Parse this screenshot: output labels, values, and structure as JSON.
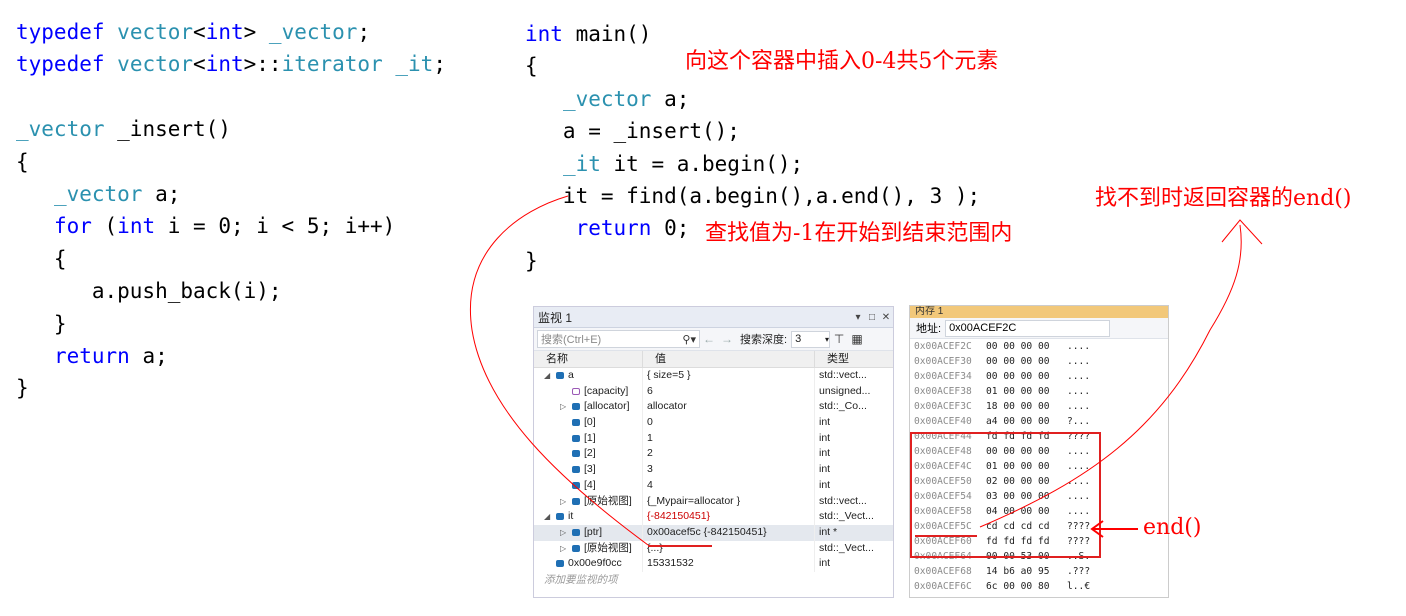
{
  "left_code": {
    "lines": [
      [
        {
          "t": "typedef",
          "c": "kw"
        },
        {
          "t": " "
        },
        {
          "t": "vector",
          "c": "ty"
        },
        {
          "t": "<"
        },
        {
          "t": "int",
          "c": "kw"
        },
        {
          "t": "> "
        },
        {
          "t": "_vector",
          "c": "ty"
        },
        {
          "t": ";"
        }
      ],
      [
        {
          "t": "typedef",
          "c": "kw"
        },
        {
          "t": " "
        },
        {
          "t": "vector",
          "c": "ty"
        },
        {
          "t": "<"
        },
        {
          "t": "int",
          "c": "kw"
        },
        {
          "t": ">::"
        },
        {
          "t": "iterator",
          "c": "ty"
        },
        {
          "t": " "
        },
        {
          "t": "_it",
          "c": "ty"
        },
        {
          "t": ";"
        }
      ],
      [],
      [
        {
          "t": "_vector",
          "c": "ty"
        },
        {
          "t": " _insert()"
        }
      ],
      [
        {
          "t": "{"
        }
      ],
      [
        {
          "t": "   "
        },
        {
          "t": "_vector",
          "c": "ty"
        },
        {
          "t": " a;"
        }
      ],
      [
        {
          "t": "   "
        },
        {
          "t": "for",
          "c": "kw"
        },
        {
          "t": " ("
        },
        {
          "t": "int",
          "c": "kw"
        },
        {
          "t": " i = 0; i < 5; i++)"
        }
      ],
      [
        {
          "t": "   {"
        }
      ],
      [
        {
          "t": "      a.push_back(i);"
        }
      ],
      [
        {
          "t": "   }"
        }
      ],
      [
        {
          "t": "   "
        },
        {
          "t": "return",
          "c": "kw"
        },
        {
          "t": " a;"
        }
      ],
      [
        {
          "t": "}"
        }
      ]
    ]
  },
  "right_code": {
    "lines": [
      [
        {
          "t": "int",
          "c": "kw"
        },
        {
          "t": " main()"
        }
      ],
      [
        {
          "t": "{"
        }
      ],
      [
        {
          "t": "   "
        },
        {
          "t": "_vector",
          "c": "ty"
        },
        {
          "t": " a;"
        }
      ],
      [
        {
          "t": "   a = _insert();"
        }
      ],
      [
        {
          "t": "   "
        },
        {
          "t": "_it",
          "c": "ty"
        },
        {
          "t": " it = a.begin();"
        }
      ],
      [
        {
          "t": "   it = find(a.begin(),a.end(), 3 );"
        }
      ],
      [
        {
          "t": "    "
        },
        {
          "t": "return",
          "c": "kw"
        },
        {
          "t": " 0;"
        }
      ],
      [
        {
          "t": "}"
        }
      ]
    ]
  },
  "annotations": {
    "insert_note": "向这个容器中插入0-4共5个元素",
    "find_note": "查找值为-1在开始到结束范围内",
    "notfound_note": "找不到时返回容器的end()",
    "end_label": "end()"
  },
  "watch": {
    "title": "监视 1",
    "search_placeholder": "搜索(Ctrl+E)",
    "search_depth_label": "搜索深度:",
    "search_depth_value": "3",
    "col_name": "名称",
    "col_value": "值",
    "col_type": "类型",
    "rows": [
      {
        "name": "a",
        "value": "{ size=5 }",
        "type": "std::vect...",
        "level": 0,
        "exp": "expanded",
        "icon": "cube",
        "vc": ""
      },
      {
        "name": "[capacity]",
        "value": "6",
        "type": "unsigned...",
        "level": 1,
        "exp": "",
        "icon": "prop",
        "vc": ""
      },
      {
        "name": "[allocator]",
        "value": "allocator",
        "type": "std::_Co...",
        "level": 1,
        "exp": "collapsed",
        "icon": "cube",
        "vc": ""
      },
      {
        "name": "[0]",
        "value": "0",
        "type": "int",
        "level": 1,
        "exp": "",
        "icon": "cube",
        "vc": ""
      },
      {
        "name": "[1]",
        "value": "1",
        "type": "int",
        "level": 1,
        "exp": "",
        "icon": "cube",
        "vc": ""
      },
      {
        "name": "[2]",
        "value": "2",
        "type": "int",
        "level": 1,
        "exp": "",
        "icon": "cube",
        "vc": ""
      },
      {
        "name": "[3]",
        "value": "3",
        "type": "int",
        "level": 1,
        "exp": "",
        "icon": "cube",
        "vc": ""
      },
      {
        "name": "[4]",
        "value": "4",
        "type": "int",
        "level": 1,
        "exp": "",
        "icon": "cube",
        "vc": ""
      },
      {
        "name": "[原始视图]",
        "value": "{_Mypair=allocator }",
        "type": "std::vect...",
        "level": 1,
        "exp": "collapsed",
        "icon": "cube",
        "vc": ""
      },
      {
        "name": "it",
        "value": "{-842150451}",
        "type": "std::_Vect...",
        "level": 0,
        "exp": "expanded",
        "icon": "cube",
        "vc": "red"
      },
      {
        "name": "[ptr]",
        "value": "0x00acef5c {-842150451}",
        "type": "int *",
        "level": 1,
        "exp": "collapsed",
        "icon": "cube",
        "vc": "",
        "sel": true
      },
      {
        "name": "[原始视图]",
        "value": "{...}",
        "type": "std::_Vect...",
        "level": 1,
        "exp": "collapsed",
        "icon": "cube",
        "vc": ""
      },
      {
        "name": "0x00e9f0cc",
        "value": "15331532",
        "type": "int",
        "level": 0,
        "exp": "",
        "icon": "cube",
        "vc": ""
      }
    ],
    "add_watch": "添加要监视的项"
  },
  "memory": {
    "title": "内存 1",
    "address_label": "地址:",
    "address_value": "0x00ACEF2C",
    "rows": [
      {
        "addr": "0x00ACEF2C",
        "hex": "00 00 00 00",
        "ascii": "...."
      },
      {
        "addr": "0x00ACEF30",
        "hex": "00 00 00 00",
        "ascii": "...."
      },
      {
        "addr": "0x00ACEF34",
        "hex": "00 00 00 00",
        "ascii": "...."
      },
      {
        "addr": "0x00ACEF38",
        "hex": "01 00 00 00",
        "ascii": "...."
      },
      {
        "addr": "0x00ACEF3C",
        "hex": "18 00 00 00",
        "ascii": "...."
      },
      {
        "addr": "0x00ACEF40",
        "hex": "a4 00 00 00",
        "ascii": "?..."
      },
      {
        "addr": "0x00ACEF44",
        "hex": "fd fd fd fd",
        "ascii": "????"
      },
      {
        "addr": "0x00ACEF48",
        "hex": "00 00 00 00",
        "ascii": "...."
      },
      {
        "addr": "0x00ACEF4C",
        "hex": "01 00 00 00",
        "ascii": "...."
      },
      {
        "addr": "0x00ACEF50",
        "hex": "02 00 00 00",
        "ascii": "...."
      },
      {
        "addr": "0x00ACEF54",
        "hex": "03 00 00 00",
        "ascii": "...."
      },
      {
        "addr": "0x00ACEF58",
        "hex": "04 00 00 00",
        "ascii": "...."
      },
      {
        "addr": "0x00ACEF5C",
        "hex": "cd cd cd cd",
        "ascii": "????"
      },
      {
        "addr": "0x00ACEF60",
        "hex": "fd fd fd fd",
        "ascii": "????"
      },
      {
        "addr": "0x00ACEF64",
        "hex": "00 00 53 00",
        "ascii": "..S."
      },
      {
        "addr": "0x00ACEF68",
        "hex": "14 b6 a0 95",
        "ascii": ".???"
      },
      {
        "addr": "0x00ACEF6C",
        "hex": "6c 00 00 80",
        "ascii": "l..€"
      }
    ]
  },
  "colors": {
    "keyword": "#0000ff",
    "type": "#2b91af",
    "annotation": "#ff0000"
  }
}
